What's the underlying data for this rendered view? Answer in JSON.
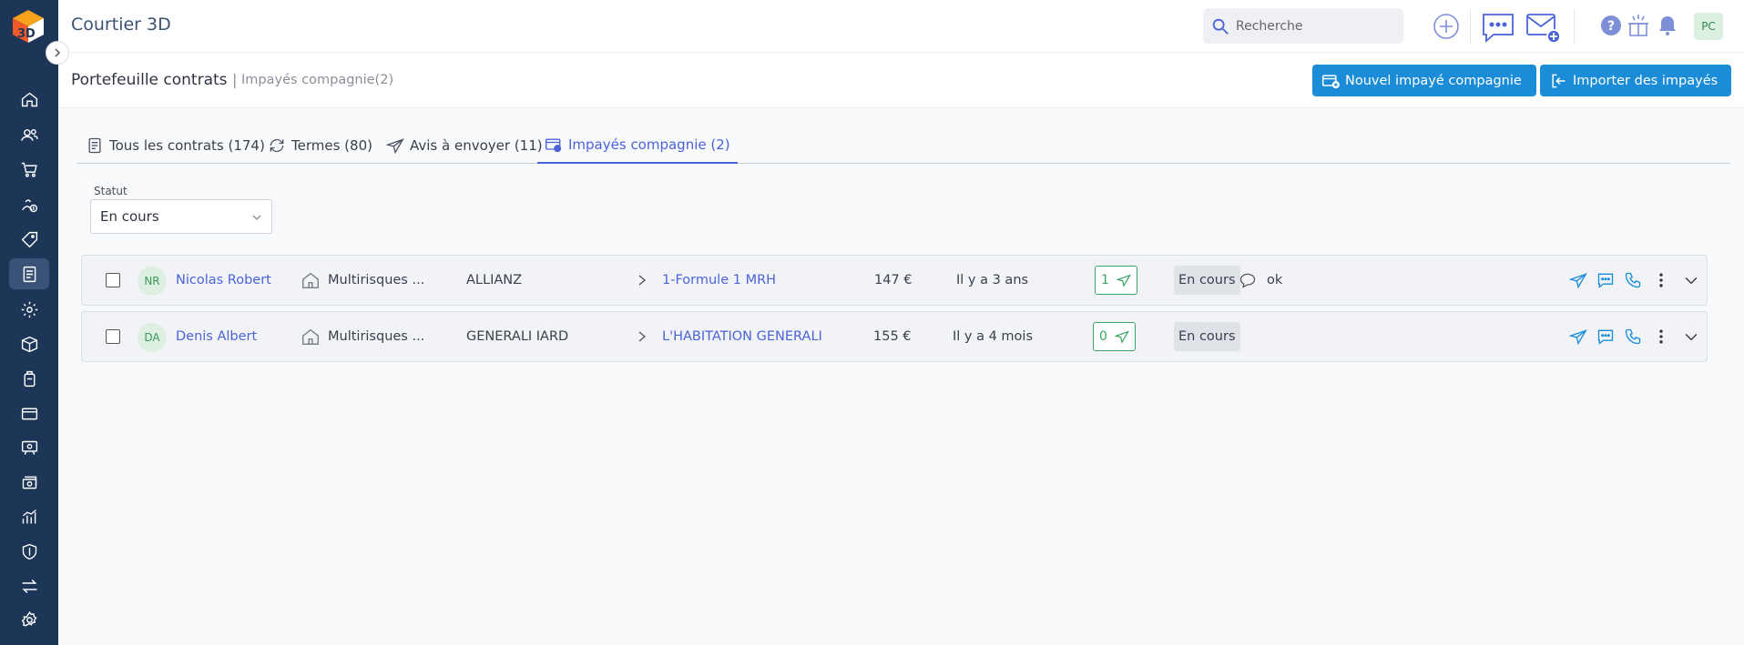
{
  "app": {
    "title": "Courtier 3D"
  },
  "search": {
    "placeholder": "Recherche"
  },
  "user": {
    "initials": "PC"
  },
  "breadcrumb": {
    "main": "Portefeuille contrats",
    "separator": "|",
    "sub": "Impayés compagnie(2)"
  },
  "actions": {
    "new_unpaid": "Nouvel impayé compagnie",
    "import": "Importer des impayés"
  },
  "tabs": [
    {
      "label": "Tous les contrats (174)",
      "icon": "contract-icon"
    },
    {
      "label": "Termes (80)",
      "icon": "refresh-icon"
    },
    {
      "label": "Avis à envoyer (11)",
      "icon": "send-icon"
    },
    {
      "label": "Impayés compagnie (2)",
      "icon": "unpaid-card-icon",
      "active": true
    }
  ],
  "filter": {
    "label": "Statut",
    "value": "En cours"
  },
  "rows": [
    {
      "initials": "NR",
      "name": "Nicolas Robert",
      "product": "Multirisques ...",
      "insurer": "ALLIANZ",
      "formula": "1-Formule 1 MRH",
      "amount": "147 €",
      "date": "Il y a 3 ans",
      "count": "1",
      "status": "En cours",
      "comment": "ok",
      "has_comment": true
    },
    {
      "initials": "DA",
      "name": "Denis Albert",
      "product": "Multirisques ...",
      "insurer": "GENERALI IARD",
      "formula": "L'HABITATION GENERALI",
      "amount": "155 €",
      "date": "Il y a 4 mois",
      "count": "0",
      "status": "En cours",
      "comment": "",
      "has_comment": false
    }
  ],
  "colors": {
    "sidebar": "#1d3557",
    "accent": "#1a8cd8",
    "link": "#4b63d8",
    "success": "#3aa565"
  }
}
